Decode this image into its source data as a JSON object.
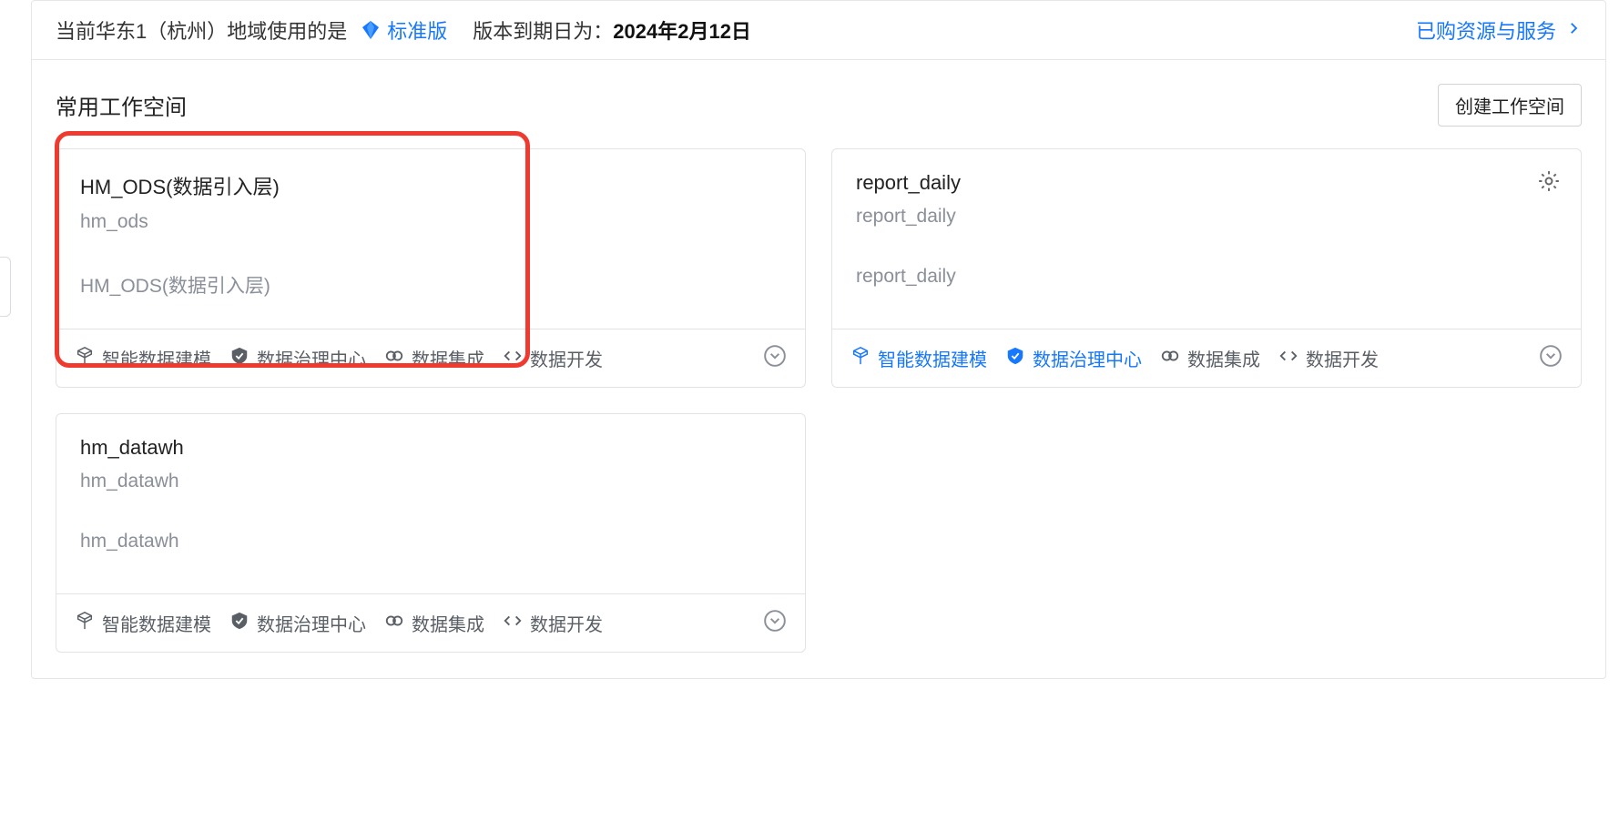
{
  "banner": {
    "region_text": "当前华东1（杭州）地域使用的是",
    "edition": "标准版",
    "expire_label": "版本到期日为：",
    "expire_date": "2024年2月12日",
    "purchased_link": "已购资源与服务"
  },
  "section": {
    "title": "常用工作空间",
    "create_button": "创建工作空间"
  },
  "tools": {
    "data_modeling": "智能数据建模",
    "data_governance": "数据治理中心",
    "data_integration": "数据集成",
    "data_develop": "数据开发"
  },
  "workspaces": [
    {
      "title": "HM_ODS(数据引入层)",
      "subtitle": "hm_ods",
      "description": "HM_ODS(数据引入层)",
      "highlighted": true,
      "colored_tools": false,
      "show_gear": false
    },
    {
      "title": "report_daily",
      "subtitle": "report_daily",
      "description": "report_daily",
      "highlighted": false,
      "colored_tools": true,
      "show_gear": true
    },
    {
      "title": "hm_datawh",
      "subtitle": "hm_datawh",
      "description": "hm_datawh",
      "highlighted": false,
      "colored_tools": false,
      "show_gear": false
    }
  ]
}
